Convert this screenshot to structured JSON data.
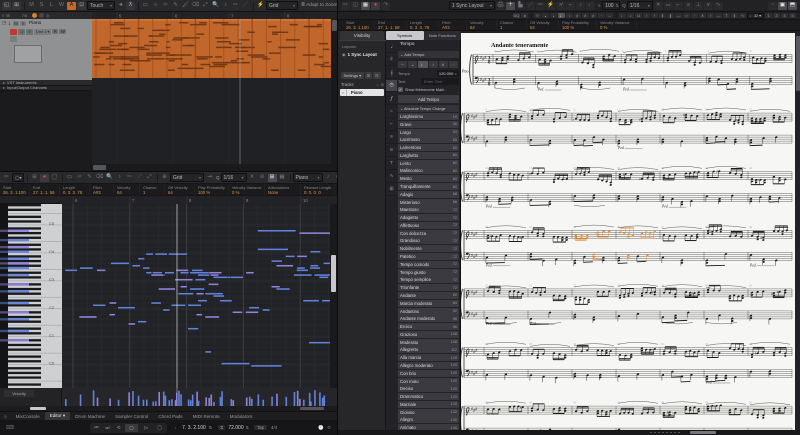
{
  "colors": {
    "part_orange": "#c2672c",
    "part_line": "#a14f1f",
    "part_note": "#6d3413",
    "note_blue": "#6283d8",
    "note_purple": "#9183dc",
    "accent_orange": "#e0953c",
    "selection_orange": "#e8872e",
    "bar_number_blue": "#9db8d2"
  },
  "project": {
    "toolbar": {
      "automation_mode": "Touch",
      "grid": "Grid",
      "adapt": "Adapt to Zoom",
      "letters": [
        "M",
        "S",
        "L",
        "W",
        "A"
      ]
    },
    "ruler": [
      "5",
      "6",
      "7",
      "8"
    ],
    "corner": "7/8",
    "track": {
      "num": "1",
      "name": "Piano",
      "m": "M",
      "s": "S",
      "e": "e",
      "out": "Drm 1",
      "r": "R",
      "w": "W"
    },
    "folders": [
      "VST Instruments",
      "Input/Output Channels"
    ]
  },
  "key_editor": {
    "toolbar": {
      "grid": "Grid",
      "q": "1/16",
      "mode": "Piano",
      "qlabel": "Q"
    },
    "info": [
      {
        "h": "Start",
        "v": "26. 3. 1.100",
        "w": 30
      },
      {
        "h": "End",
        "v": "27. 1. 1. 58",
        "w": 30
      },
      {
        "h": "Length",
        "v": "0. 3. 3. 78",
        "w": 30
      },
      {
        "h": "Pitch",
        "v": "A#3",
        "w": 24
      },
      {
        "h": "Velocity",
        "v": "64",
        "w": 26
      },
      {
        "h": "Chance",
        "v": "1",
        "w": 25
      },
      {
        "h": "Off Velocity",
        "v": "64",
        "w": 30
      },
      {
        "h": "Play Probability",
        "v": "100 %",
        "w": 34
      },
      {
        "h": "Velocity Variance",
        "v": "0 %",
        "w": 36
      },
      {
        "h": "Articulations",
        "v": "None",
        "w": 36
      },
      {
        "h": "Release Length",
        "v": "0. 0. 0. 0",
        "w": 34
      }
    ],
    "ruler": [
      "6",
      "7",
      "8",
      "9",
      "10"
    ],
    "octaves": [
      "C5",
      "C4",
      "C3",
      "C2",
      "C1",
      "C0"
    ],
    "velocity_label": "Velocity",
    "tabs": [
      "MixConsole",
      "Editor",
      "Drum Machine",
      "Sampler Control",
      "Chord Pads",
      "MIDI Remote",
      "Modulators"
    ],
    "active_tab": "Editor"
  },
  "transport": {
    "position": "7. 3. 2.100",
    "tempo": "72.000",
    "tap": "Tap",
    "sig": "4/4"
  },
  "score": {
    "toolbar": {
      "layout": "1 Sync Layout",
      "value": "100",
      "q": "1/16",
      "qlabel": "Q",
      "dq": "DQ",
      "tuplet": "32",
      "nums": [
        "1",
        "2",
        "3",
        "5"
      ]
    },
    "info": [
      {
        "h": "Start",
        "v": "26. 3. 1.100",
        "w": 32
      },
      {
        "h": "End",
        "v": "27. 1. 1. 58",
        "w": 32
      },
      {
        "h": "Length",
        "v": "0. 3. 3. 78",
        "w": 32
      },
      {
        "h": "Pitch",
        "v": "A#3",
        "w": 28
      },
      {
        "h": "Velocity",
        "v": "64",
        "w": 30
      },
      {
        "h": "Chance",
        "v": "1",
        "w": 30
      },
      {
        "h": "Off Velocity",
        "v": "64",
        "w": 32
      },
      {
        "h": "Play Probability",
        "v": "100 %",
        "w": 38
      },
      {
        "h": "Velocity Variance",
        "v": "0 %",
        "w": 40
      }
    ],
    "visibility": {
      "tab": "Visibility",
      "layouts": "Layouts",
      "layout_name": "1 Sync Layout",
      "settings": "Settings",
      "tracks": "Tracks",
      "track": "Piano"
    },
    "symbols": {
      "tabs": [
        "Symbols",
        "Note Functions"
      ],
      "title": "Tempo",
      "add_tempo_header": "Add Tempo",
      "tempo_label": "Tempo",
      "tempo_value": "120.000",
      "text_label": "Text",
      "text_placeholder": "Enter Text",
      "metronome": "Show Metronome Mark",
      "add_button": "Add Tempo",
      "abs_header": "Absolute Tempo Change",
      "list": [
        {
          "name": "Larghissimo",
          "bpm": "19"
        },
        {
          "name": "Grave",
          "bpm": "36"
        },
        {
          "name": "Largo",
          "bpm": "53"
        },
        {
          "name": "Lacrimoso",
          "bpm": "60"
        },
        {
          "name": "Lamentoso",
          "bpm": "60"
        },
        {
          "name": "Larghetto",
          "bpm": "60"
        },
        {
          "name": "Lento",
          "bpm": "60"
        },
        {
          "name": "Malinconico",
          "bpm": "60"
        },
        {
          "name": "Mesto",
          "bpm": "60"
        },
        {
          "name": "Tranquillamente",
          "bpm": "60"
        },
        {
          "name": "Adagio",
          "bpm": "68"
        },
        {
          "name": "Misterioso",
          "bpm": "68"
        },
        {
          "name": "Maestoso",
          "bpm": "72"
        },
        {
          "name": "Adagietto",
          "bpm": "72"
        },
        {
          "name": "Affettuoso",
          "bpm": "72"
        },
        {
          "name": "Con dolcezza",
          "bpm": "72"
        },
        {
          "name": "Grandioso",
          "bpm": "72"
        },
        {
          "name": "Nobilmente",
          "bpm": "72"
        },
        {
          "name": "Patetico",
          "bpm": "72"
        },
        {
          "name": "Tempo comodo",
          "bpm": "72"
        },
        {
          "name": "Tempo giusto",
          "bpm": "72"
        },
        {
          "name": "Tempo semplice",
          "bpm": "72"
        },
        {
          "name": "Trionfante",
          "bpm": "72"
        },
        {
          "name": "Andante",
          "bpm": "80"
        },
        {
          "name": "Marcia moderato",
          "bpm": "84"
        },
        {
          "name": "Andantino",
          "bpm": "92"
        },
        {
          "name": "Andante moderato",
          "bpm": "96"
        },
        {
          "name": "Eroico",
          "bpm": "96"
        },
        {
          "name": "Grazioso",
          "bpm": "108"
        },
        {
          "name": "Moderato",
          "bpm": "108"
        },
        {
          "name": "Allegretto",
          "bpm": "112"
        },
        {
          "name": "Alla marcia",
          "bpm": "120"
        },
        {
          "name": "Allegro moderato",
          "bpm": "120"
        },
        {
          "name": "Con brio",
          "bpm": "120"
        },
        {
          "name": "Con moto",
          "bpm": "120"
        },
        {
          "name": "Deciso",
          "bpm": "120"
        },
        {
          "name": "Drammatico",
          "bpm": "120"
        },
        {
          "name": "Marziale",
          "bpm": "120"
        },
        {
          "name": "Gioioso",
          "bpm": "132"
        },
        {
          "name": "Allegro",
          "bpm": "140"
        },
        {
          "name": "Animato",
          "bpm": "140"
        }
      ]
    },
    "page": {
      "tempo_text": "Andante teneramente",
      "instrument": "Pno.",
      "time_sig_upper": "3",
      "time_sig_lower": "8",
      "pedal": "Ped."
    }
  }
}
